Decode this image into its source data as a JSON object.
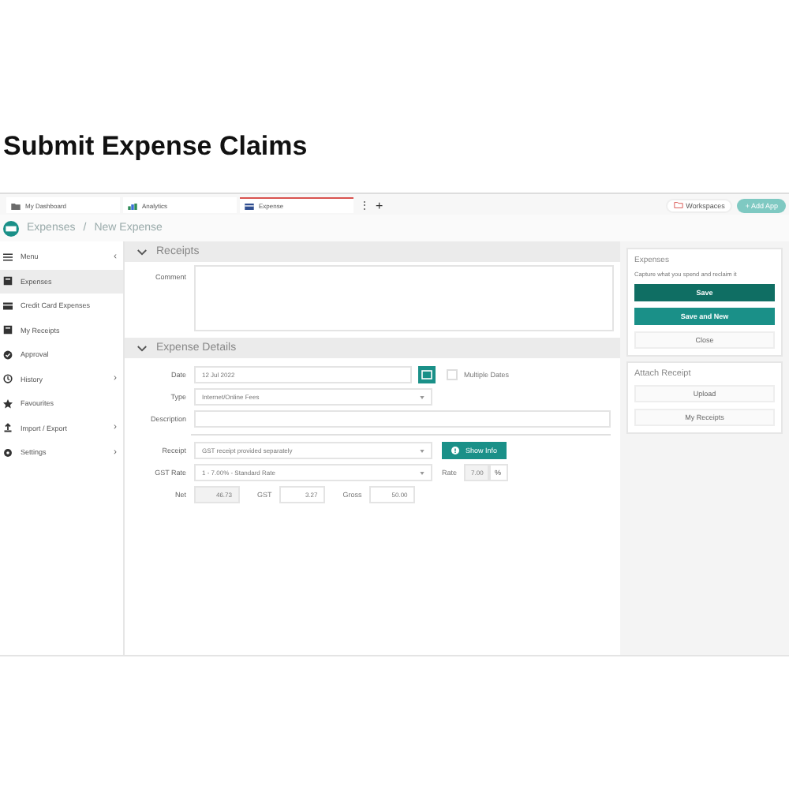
{
  "page_title": "Submit Expense Claims",
  "tabs": [
    {
      "label": "My Dashboard",
      "selected": false
    },
    {
      "label": "Analytics",
      "selected": false
    },
    {
      "label": "Expense",
      "selected": true
    }
  ],
  "tab_more": "⋮",
  "tab_add": "+",
  "workspaces": "Workspaces",
  "add_app": "+ Add App",
  "breadcrumb": [
    "Expenses",
    "New Expense"
  ],
  "breadcrumb_sep": "/",
  "sidebar": {
    "items": [
      {
        "label": "Menu",
        "selected": false,
        "collapse": "‹"
      },
      {
        "label": "Expenses",
        "selected": true
      },
      {
        "label": "Credit Card Expenses",
        "selected": false
      },
      {
        "label": "My Receipts",
        "selected": false
      },
      {
        "label": "Approval",
        "selected": false
      },
      {
        "label": "History",
        "selected": false,
        "submenu": "›"
      },
      {
        "label": "Favourites",
        "selected": false
      },
      {
        "label": "Import / Export",
        "selected": false,
        "submenu": "›"
      },
      {
        "label": "Settings",
        "selected": false,
        "submenu": "›"
      }
    ]
  },
  "receipts": {
    "title": "Receipts",
    "expanded": true,
    "comment_label": "Comment"
  },
  "details": {
    "title": "Expense Details",
    "expanded": true,
    "date_label": "Date",
    "date": "12 Jul 2022",
    "multiple_dates": {
      "label": "Multiple Dates",
      "checked": false
    },
    "type_label": "Type",
    "type": "Internet/Online Fees",
    "description_label": "Description",
    "receipt_label": "Receipt",
    "receipt": "GST receipt provided separately",
    "show_info": "Show Info",
    "gst_rate_label": "GST Rate",
    "gst_rate": "1 - 7.00% - Standard Rate",
    "rate_label": "Rate",
    "rate": "7.00",
    "percent": "%",
    "net_label": "Net",
    "net": "46.73",
    "gst_label": "GST",
    "gst": "3.27",
    "gross_label": "Gross",
    "gross": "50.00"
  },
  "actions": {
    "title": "Expenses",
    "subtitle": "Capture what you spend and reclaim it",
    "buttons": [
      {
        "label": "Save",
        "kind": "primary"
      },
      {
        "label": "Save and New",
        "kind": "secondary"
      },
      {
        "label": "Close",
        "kind": "plain"
      }
    ]
  },
  "attach": {
    "title": "Attach Receipt",
    "buttons": [
      {
        "label": "Upload",
        "kind": "plain"
      },
      {
        "label": "My Receipts",
        "kind": "plain"
      }
    ]
  }
}
